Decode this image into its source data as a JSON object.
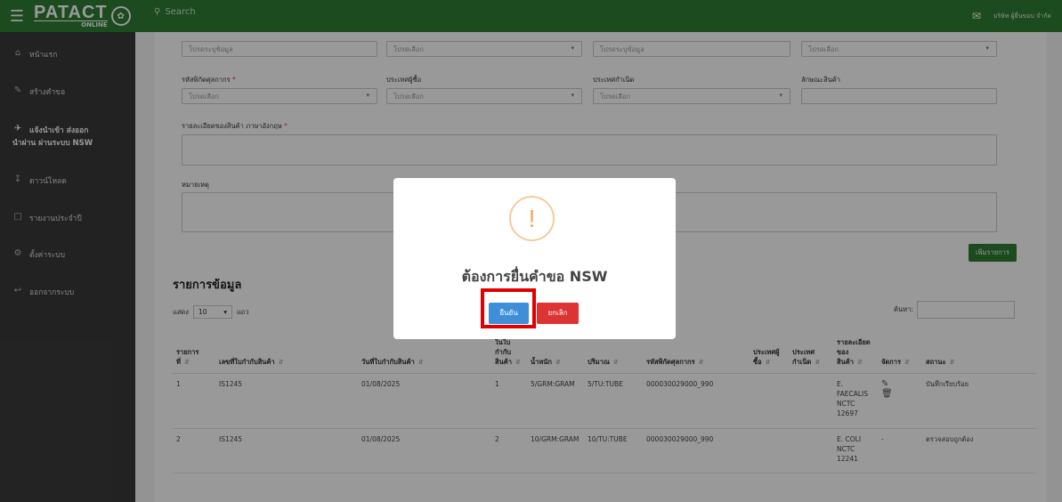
{
  "topbar": {
    "logo_main": "PATACT",
    "logo_sub": "ONLINE",
    "search_placeholder": "Search",
    "company": "บริษัท ผู้ยื่นขอบ จำกัด"
  },
  "sidebar": {
    "items": [
      {
        "label": "หน้าแรก",
        "icon": "home-icon"
      },
      {
        "label": "สร้างคำขอ",
        "icon": "pencil-icon"
      },
      {
        "label": "แจ้งนำเข้า ส่งออก",
        "label2": "นำผ่าน ผ่านระบบ NSW",
        "icon": "airplane-icon",
        "active": true
      },
      {
        "label": "ดาวน์โหลด",
        "icon": "download-icon"
      },
      {
        "label": "รายงานประจำปี",
        "icon": "document-icon"
      },
      {
        "label": "ตั้งค่าระบบ",
        "icon": "gear-icon"
      },
      {
        "label": "ออกจากระบบ",
        "icon": "logout-icon"
      }
    ]
  },
  "form": {
    "row1": [
      "โปรดระบุข้อมูล",
      "โปรดเลือก",
      "โปรดระบุข้อมูล",
      "โปรดเลือก"
    ],
    "hs_label": "รหัสพิกัดศุลกากร",
    "hs_placeholder": "โปรดเลือก",
    "buyer_country_label": "ประเทศผู้ซื้อ",
    "buyer_country_placeholder": "โปรดเลือก",
    "origin_label": "ประเทศกำเนิด",
    "origin_placeholder": "โปรดเลือก",
    "product_char_label": "ลักษณะสินค้า",
    "desc_label": "รายละเอียดของสินค้า ภาษาอังกฤษ",
    "note_label": "หมายเหตุ",
    "add_button": "เพิ่มรายการ",
    "required_mark": "*"
  },
  "list": {
    "title": "รายการข้อมูล",
    "show_label": "แสดง",
    "show_value": "10",
    "show_unit": "แถว",
    "search_label": "ค้นหา:",
    "columns": [
      "รายการที่",
      "เลขที่ใบกำกับสินค้า",
      "วันที่ใบกำกับสินค้า",
      "รายการในใบกำกับสินค้า",
      "น้ำหนัก",
      "ปริมาณ",
      "รหัสพิกัดศุลกากร",
      "ประเทศผู้ซื้อ",
      "ประเทศกำเนิด",
      "รายละเอียดของสินค้า",
      "จัดการ",
      "สถานะ"
    ],
    "rows": [
      {
        "no": "1",
        "invoice": "IS1245",
        "date": "01/08/2025",
        "item": "1",
        "weight": "5/GRM:GRAM",
        "qty": "5/TU:TUBE",
        "hs": "000030029000_990",
        "buyer": "",
        "origin": "",
        "desc": "E. FAECALIS NCTC 12697",
        "manage": "edit-delete",
        "status": "บันทึกเรียบร้อย"
      },
      {
        "no": "2",
        "invoice": "IS1245",
        "date": "01/08/2025",
        "item": "2",
        "weight": "10/GRM:GRAM",
        "qty": "10/TU:TUBE",
        "hs": "000030029000_990",
        "buyer": "",
        "origin": "",
        "desc": "E. COLI NCTC 12241",
        "manage": "-",
        "status": "ตรวจสอบถูกต้อง"
      }
    ]
  },
  "modal": {
    "title": "ต้องการยื่นคำขอ NSW",
    "confirm": "ยืนยัน",
    "cancel": "ยกเลิก",
    "icon": "warning-icon"
  }
}
